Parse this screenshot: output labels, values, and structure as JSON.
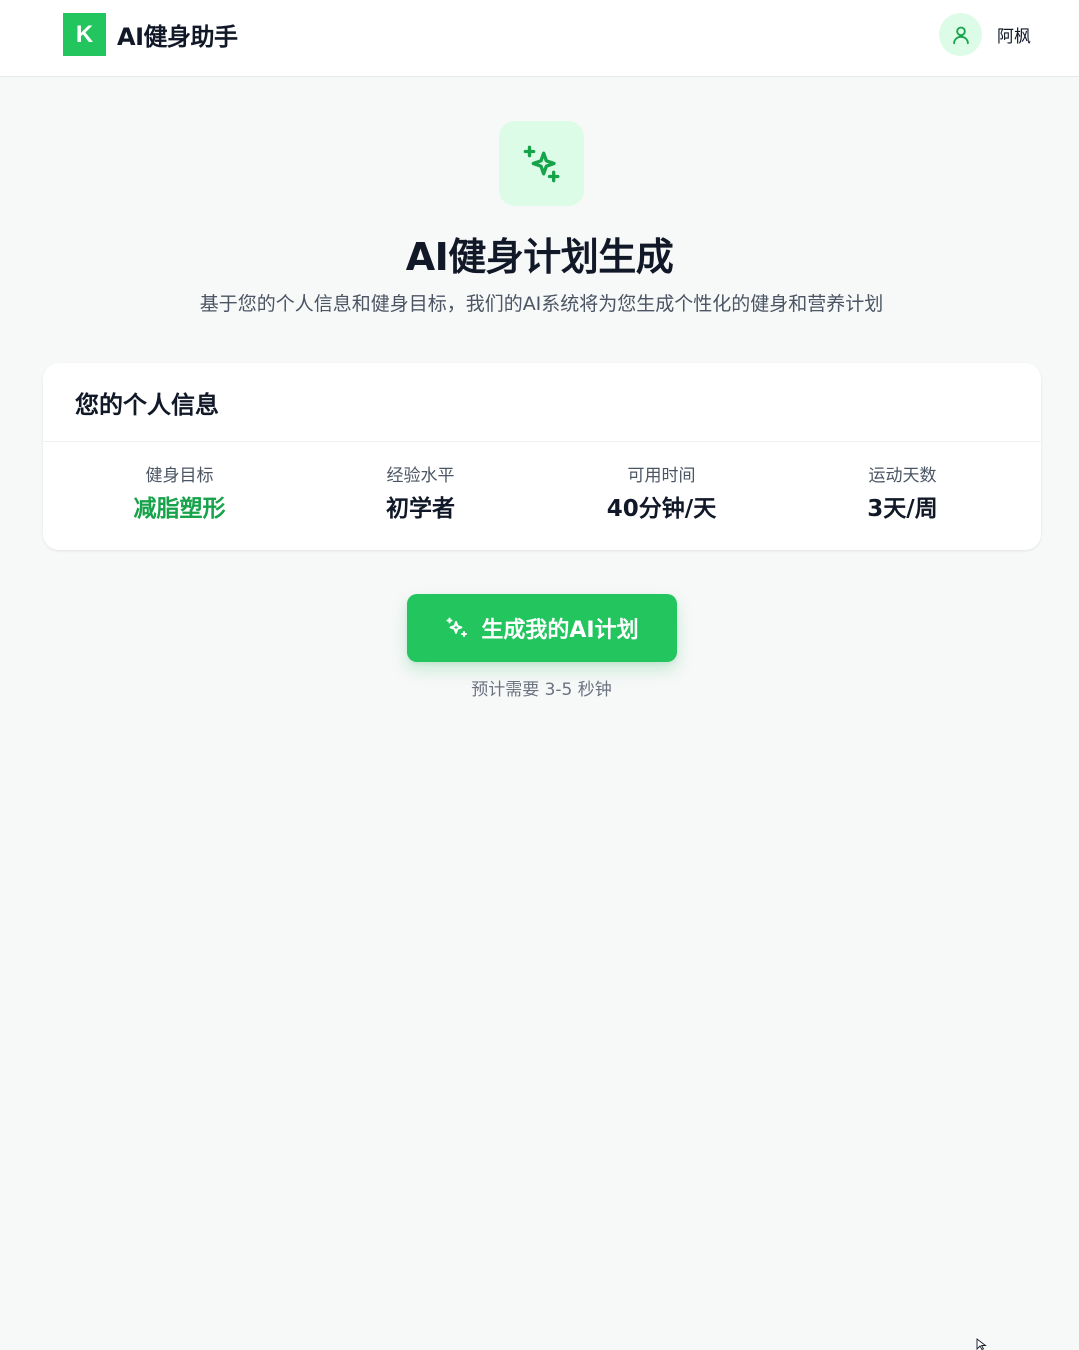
{
  "header": {
    "logo_letter": "K",
    "app_name": "AI健身助手",
    "user_name": "阿枫"
  },
  "hero": {
    "icon": "sparkles-icon",
    "title": "AI健身计划生成",
    "subtitle": "基于您的个人信息和健身目标，我们的AI系统将为您生成个性化的健身和营养计划"
  },
  "profile_card": {
    "title": "您的个人信息",
    "stats": [
      {
        "label": "健身目标",
        "value": "减脂塑形"
      },
      {
        "label": "经验水平",
        "value": "初学者"
      },
      {
        "label": "可用时间",
        "value": "40分钟/天"
      },
      {
        "label": "运动天数",
        "value": "3天/周"
      }
    ]
  },
  "action": {
    "button_label": "生成我的AI计划",
    "button_icon": "sparkles-icon",
    "hint": "预计需要 3-5 秒钟"
  },
  "colors": {
    "accent": "#22c55e",
    "accent_dark": "#16a34a",
    "accent_light": "#dcfce7",
    "background": "#f7f8f8"
  }
}
